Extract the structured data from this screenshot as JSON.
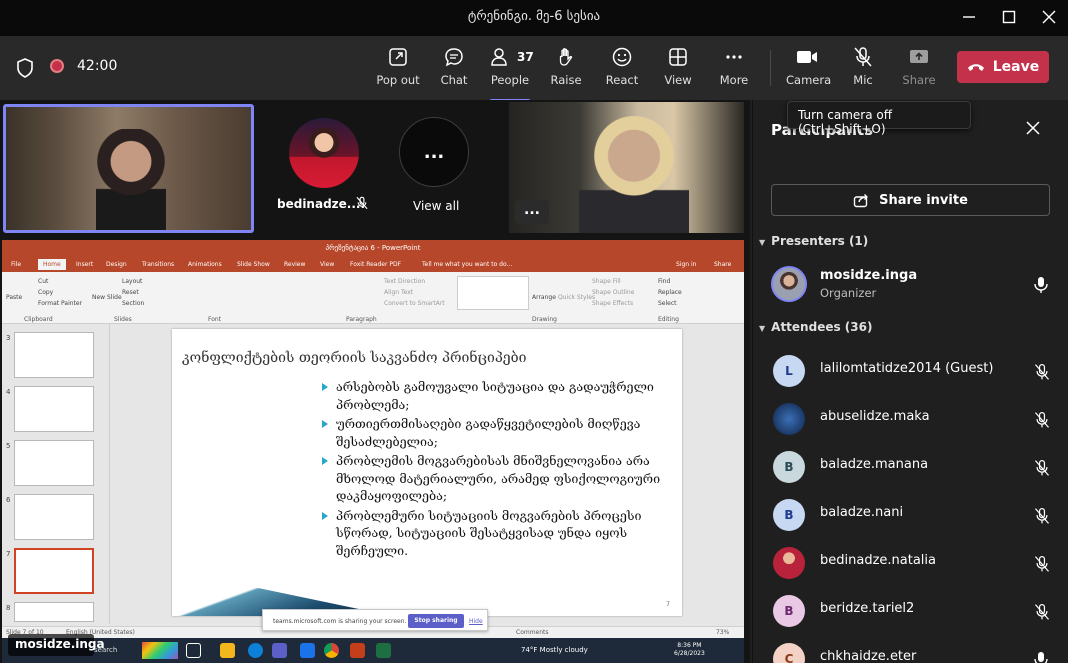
{
  "window": {
    "title": "ტრენინგი. მე-6 სესია"
  },
  "toolbar": {
    "timer": "42:00",
    "popout_label": "Pop out",
    "chat_label": "Chat",
    "people_label": "People",
    "people_count": "37",
    "raise_label": "Raise",
    "react_label": "React",
    "view_label": "View",
    "more_label": "More",
    "camera_label": "Camera",
    "mic_label": "Mic",
    "share_label": "Share",
    "leave_label": "Leave",
    "camera_tooltip": "Turn camera off (Ctrl+Shift+O)"
  },
  "stage": {
    "tile_name": "bedinadze....",
    "view_all_label": "View all",
    "more_glyph": "...",
    "self_name": "mosidze.inga"
  },
  "powerpoint": {
    "title": "პრეზენტაცია 6 - PowerPoint",
    "tabs": [
      "File",
      "Home",
      "Insert",
      "Design",
      "Transitions",
      "Animations",
      "Slide Show",
      "Review",
      "View",
      "Foxit Reader PDF",
      "Tell me what you want to do..."
    ],
    "sign_in": "Sign in",
    "share": "Share",
    "ribbon_groups": [
      "Clipboard",
      "Slides",
      "Font",
      "Paragraph",
      "Drawing",
      "Editing"
    ],
    "ribbon_items": [
      "Paste",
      "Cut",
      "Copy",
      "Format Painter",
      "New Slide",
      "Layout",
      "Reset",
      "Section",
      "Text Direction",
      "Align Text",
      "Convert to SmartArt",
      "Arrange",
      "Quick Styles",
      "Shape Fill",
      "Shape Outline",
      "Shape Effects",
      "Find",
      "Replace",
      "Select"
    ],
    "thumb_numbers": [
      "3",
      "4",
      "5",
      "6",
      "7",
      "8"
    ],
    "slide_title": "კონფლიქტების თეორიის საკვანძო პრინციპები",
    "bullets": [
      "არსებობს გამოუვალი სიტუაცია და გადაუჭრელი პრობლემა;",
      "ურთიერთმისაღები გადაწყვეტილების მიღწევა შესაძლებელია;",
      "პრობლემის მოგვარებისას მნიშვნელოვანია არა მხოლოდ მატერიალური, არამედ ფსიქოლოგიური დაკმაყოფილება;",
      "პრობლემური სიტუაციის მოგვარების პროცესი სწორად, სიტუაციის შესატყვისად უნდა იყოს შერჩეული."
    ],
    "slide_number": "7",
    "status_slide": "Slide 7 of 10",
    "status_lang": "English (United States)",
    "status_comments": "Comments",
    "status_zoom": "73%",
    "share_banner_text": "teams.microsoft.com is sharing your screen.",
    "stop_sharing": "Stop sharing",
    "hide": "Hide",
    "search_label": "search",
    "weather": "74°F  Mostly cloudy",
    "clock_time": "8:36 PM",
    "clock_date": "6/28/2023"
  },
  "panel": {
    "title": "Participants",
    "share_invite": "Share invite",
    "presenters_header": "Presenters (1)",
    "attendees_header": "Attendees (36)",
    "presenters": [
      {
        "name": "mosidze.inga",
        "role": "Organizer"
      }
    ],
    "attendees": [
      {
        "name": "lalilomtatidze2014 (Guest)",
        "initial": "L",
        "avatar_color": "#c7d8f2"
      },
      {
        "name": "abuselidze.maka",
        "initial": "",
        "avatar_color": "#1a3a6a"
      },
      {
        "name": "baladze.manana",
        "initial": "B",
        "avatar_color": "#c9d8dd"
      },
      {
        "name": "baladze.nani",
        "initial": "B",
        "avatar_color": "#c7d8f2"
      },
      {
        "name": "bedinadze.natalia",
        "initial": "",
        "avatar_color": "#b8223a"
      },
      {
        "name": "beridze.tariel2",
        "initial": "B",
        "avatar_color": "#e9c8e6"
      },
      {
        "name": "chkhaidze.eter",
        "initial": "C",
        "avatar_color": "#f3d1c4"
      }
    ]
  },
  "colors": {
    "accent": "#7f85f5",
    "leave": "#c4314b",
    "ppt": "#b7472a"
  }
}
